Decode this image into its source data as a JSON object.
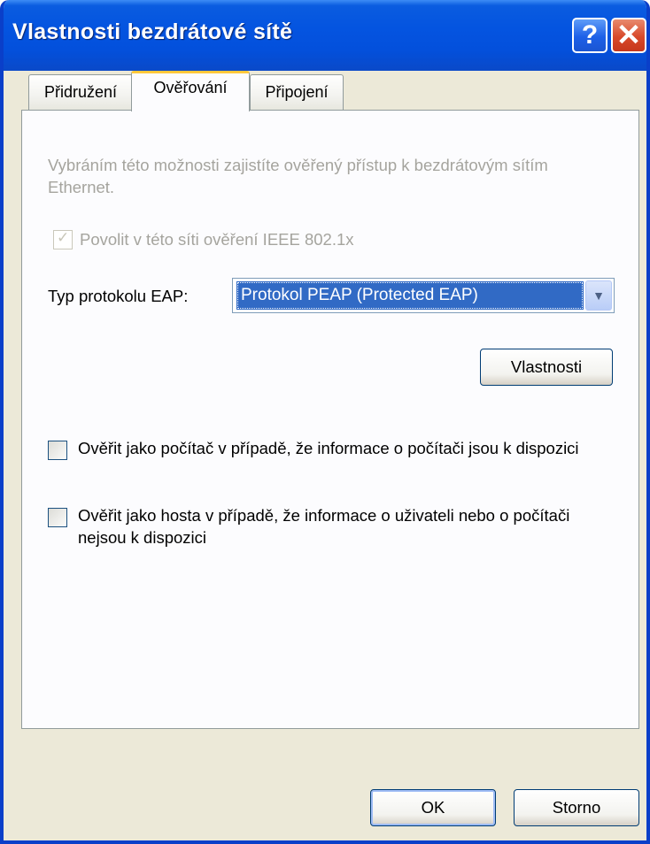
{
  "window": {
    "title": "Vlastnosti bezdrátové sítě",
    "help_label": "?",
    "close_label": "✕"
  },
  "tabs": [
    {
      "label": "Přidružení",
      "active": false
    },
    {
      "label": "Ověřování",
      "active": true
    },
    {
      "label": "Připojení",
      "active": false
    }
  ],
  "panel": {
    "description": "Vybráním této možnosti zajistíte ověřený přístup k bezdrátovým sítím Ethernet.",
    "ieee_checkbox": {
      "label": "Povolit v této síti ověření IEEE 802.1x",
      "checked": true,
      "enabled": false
    },
    "eap_label": "Typ protokolu EAP:",
    "eap_value": "Protokol PEAP (Protected EAP)",
    "properties_button": "Vlastnosti",
    "computer_checkbox": {
      "label": "Ověřit jako počítač v případě, že informace o počítači jsou k dispozici",
      "checked": false
    },
    "guest_checkbox": {
      "label": "Ověřit jako hosta v případě, že informace o uživateli nebo o počítači nejsou k dispozici",
      "checked": false
    }
  },
  "footer": {
    "ok_button": "OK",
    "cancel_button": "Storno"
  },
  "colors": {
    "titlebar": "#0454e0",
    "dialog_bg": "#ece9d8",
    "selection": "#316ac5",
    "active_tab_accent": "#ffc83c"
  }
}
